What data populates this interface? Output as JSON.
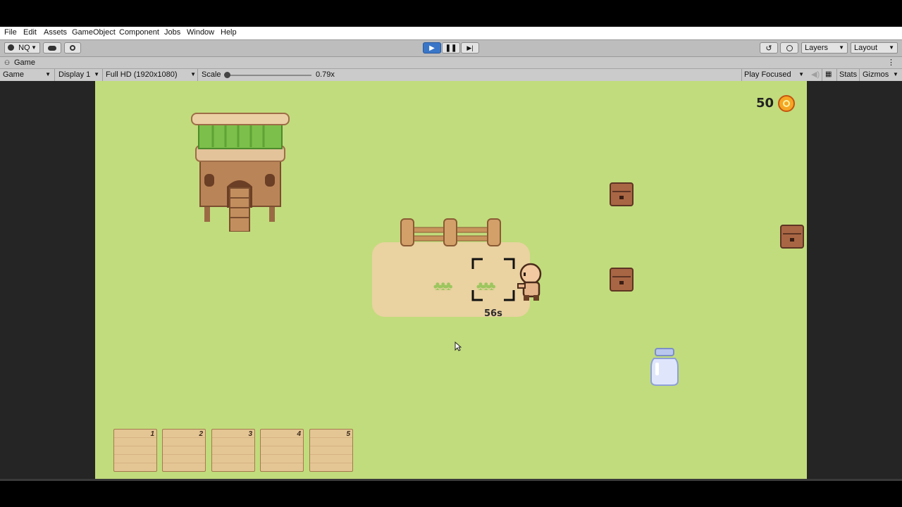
{
  "menu": {
    "items": [
      "File",
      "Edit",
      "Assets",
      "GameObject",
      "Component",
      "Jobs",
      "Window",
      "Help"
    ]
  },
  "toolbar": {
    "account_label": "NQ",
    "layers_label": "Layers",
    "layout_label": "Layout"
  },
  "tab": {
    "title": "Game"
  },
  "game_bar": {
    "view_label": "Game",
    "display_label": "Display 1",
    "resolution_label": "Full HD (1920x1080)",
    "scale_label": "Scale",
    "scale_value": "0.79x",
    "scale_fraction": 0.0,
    "play_mode_label": "Play Focused",
    "stats_label": "Stats",
    "gizmos_label": "Gizmos"
  },
  "hud": {
    "coin_count": "50",
    "coin_icon": "coin-icon",
    "crop_timer": "56s"
  },
  "inventory": {
    "slots": [
      "1",
      "2",
      "3",
      "4",
      "5"
    ]
  },
  "colors": {
    "grass": "#c1dc7c",
    "dirt": "#ead2a1",
    "play_active": "#3a76c8"
  }
}
